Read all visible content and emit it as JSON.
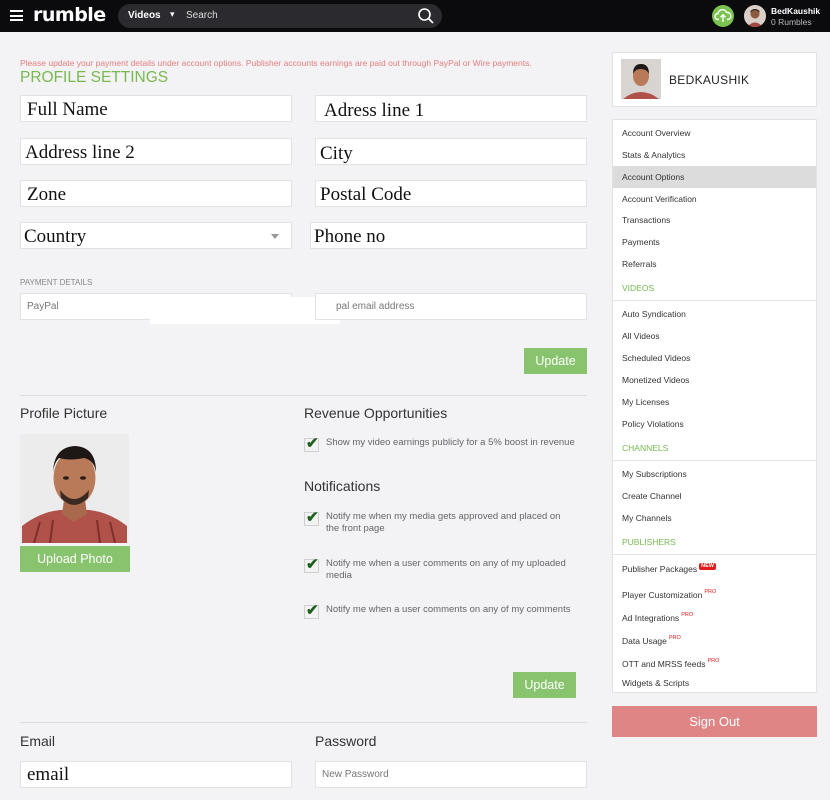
{
  "topbar": {
    "logo": "rumble",
    "search_category": "Videos",
    "search_placeholder": "Search",
    "username": "BedKaushik",
    "rumbles": "0 Rumbles"
  },
  "notice": "Please update your payment details under account options. Publisher accounts earnings are paid out through PayPal or Wire payments.",
  "profile_settings": {
    "heading": "PROFILE SETTINGS",
    "full_name": "Full Name",
    "address_line_1": "Adress line 1",
    "address_line_2": "Address line 2",
    "city": "City",
    "zone": "Zone",
    "postal_code": "Postal Code",
    "country": "Country",
    "phone": "Phone no"
  },
  "payment": {
    "label": "PAYMENT DETAILS",
    "method": "PayPal",
    "email_placeholder": "pal email address",
    "update_label": "Update"
  },
  "profile_picture": {
    "title": "Profile Picture",
    "upload_label": "Upload Photo"
  },
  "revenue": {
    "title": "Revenue Opportunities",
    "option": "Show my video earnings publicly for a 5% boost in revenue",
    "option_checked": true
  },
  "notifications": {
    "title": "Notifications",
    "options": [
      {
        "label": "Notify me when my media gets approved and placed on the front page",
        "checked": true
      },
      {
        "label": "Notify me when a user comments on any of my uploaded media",
        "checked": true
      },
      {
        "label": "Notify me when a user comments on any of my comments",
        "checked": true
      }
    ],
    "update_label": "Update"
  },
  "account": {
    "email_title": "Email",
    "email_value": "email",
    "password_title": "Password",
    "password_placeholder": "New Password"
  },
  "sidebar": {
    "username": "BEDKAUSHIK",
    "items": [
      {
        "label": "Account Overview"
      },
      {
        "label": "Stats & Analytics"
      },
      {
        "label": "Account Options",
        "active": true
      },
      {
        "label": "Account Verification"
      },
      {
        "label": "Transactions"
      },
      {
        "label": "Payments"
      },
      {
        "label": "Referrals"
      }
    ],
    "videos_section": "VIDEOS",
    "video_items": [
      {
        "label": "Auto Syndication"
      },
      {
        "label": "All Videos"
      },
      {
        "label": "Scheduled Videos"
      },
      {
        "label": "Monetized Videos"
      },
      {
        "label": "My Licenses"
      },
      {
        "label": "Policy Violations"
      }
    ],
    "channels_section": "CHANNELS",
    "channel_items": [
      {
        "label": "My Subscriptions"
      },
      {
        "label": "Create Channel"
      },
      {
        "label": "My Channels"
      }
    ],
    "publishers_section": "PUBLISHERS",
    "publisher_items": [
      {
        "label": "Publisher Packages",
        "badge": "NEW"
      },
      {
        "label": "Player Customization",
        "badge": "PRO"
      },
      {
        "label": "Ad Integrations",
        "badge": "PRO"
      },
      {
        "label": "Data Usage",
        "badge": "PRO"
      },
      {
        "label": "OTT and MRSS feeds",
        "badge": "PRO"
      },
      {
        "label": "Widgets & Scripts"
      }
    ],
    "signout_label": "Sign Out"
  },
  "colors": {
    "accent_green": "#75b94f",
    "button_green": "#88c46d",
    "signout_red": "#e08585",
    "notice_red": "#e57f7f",
    "badge_red": "#e21b1b"
  }
}
